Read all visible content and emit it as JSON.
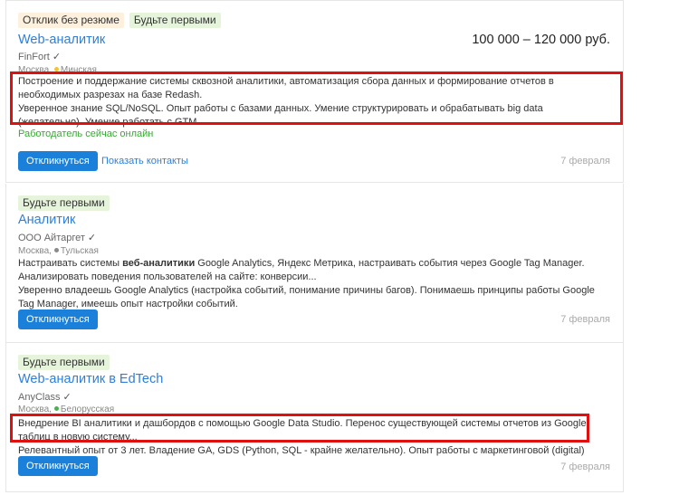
{
  "vacancies": [
    {
      "badges": [
        "Отклик без резюме",
        "Будьте первыми"
      ],
      "title": "Web-аналитик",
      "salary": "100 000 – 120 000 руб.",
      "company": "FinFort",
      "city": "Москва,",
      "metro": "Минская",
      "metro_color": "#f4c430",
      "description": [
        "Построение и поддержание системы сквозной аналитики, автоматизация сбора данных и формирование отчетов в необходимых разрезах на базе Redash.",
        "Уверенное знание SQL/NoSQL. Опыт работы с базами данных. Умение структурировать и обрабатывать big data (желательно). Умение работать с GTM..."
      ],
      "online": "Работодатель сейчас онлайн",
      "apply_label": "Откликнуться",
      "contacts_label": "Показать контакты",
      "date": "7 февраля"
    },
    {
      "badges": [
        "Будьте первыми"
      ],
      "title": "Аналитик",
      "company": "ООО Айтаргет",
      "city": "Москва,",
      "metro": "Тульская",
      "metro_color": "#8a8a8a",
      "desc_parts": [
        "Настраивать системы ",
        "веб-аналитики",
        " Google Analytics, Яндекс Метрика, настраивать события через Google Tag Manager. Анализировать поведения пользователей на сайте: конверсии..."
      ],
      "desc_line2": "Уверенно владеешь Google Analytics (настройка событий, понимание причины багов). Понимаешь принципы работы Google Tag Manager, имеешь опыт настройки событий.",
      "apply_label": "Откликнуться",
      "date": "7 февраля"
    },
    {
      "badges": [
        "Будьте первыми"
      ],
      "title": "Web-аналитик в EdTech",
      "company": "AnyClass",
      "city": "Москва,",
      "metro": "Белорусская",
      "metro_color": "#4caf50",
      "description": [
        "Внедрение BI аналитики и дашбордов с помощью Google Data Studio. Перенос существующей системы отчетов из Google таблиц в новую систему...",
        "Релевантный опыт от 3 лет. Владение GA, GDS (Python, SQL - крайне желательно). Опыт работы с маркетинговой (digital) аналитикой."
      ],
      "apply_label": "Откликнуться",
      "date": "7 февраля"
    }
  ],
  "colors": {
    "accent": "#1a80d9",
    "link": "#2f7fd8",
    "online": "#3aa836",
    "highlight": "#e01010"
  }
}
